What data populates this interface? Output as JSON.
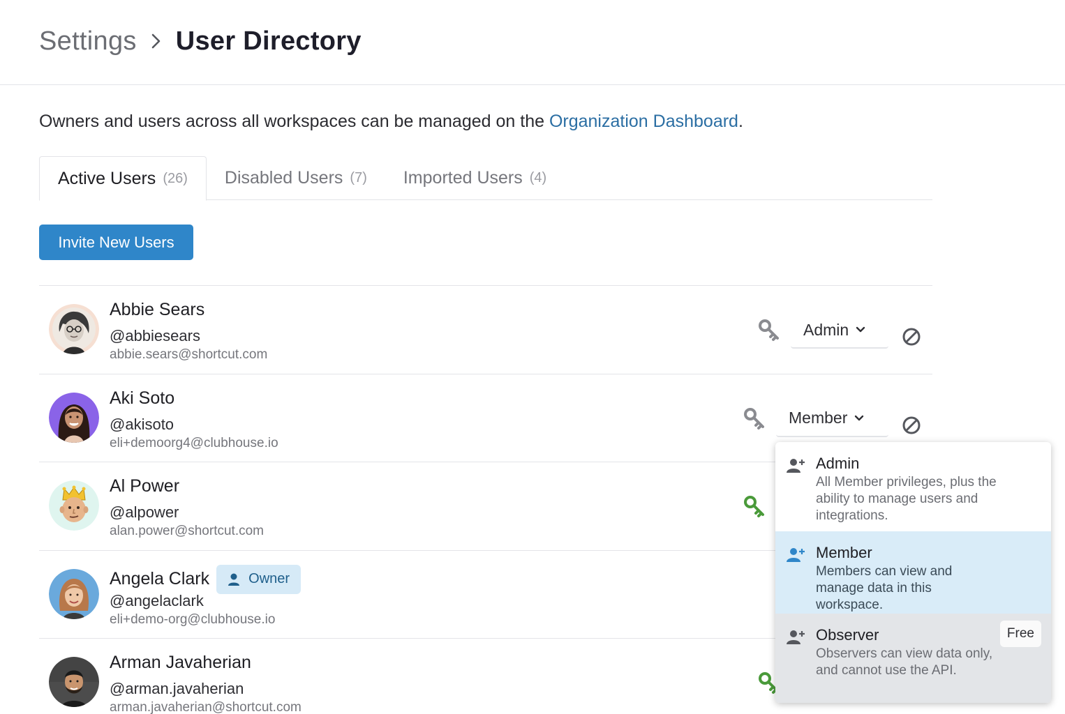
{
  "breadcrumb": {
    "parent": "Settings",
    "current": "User Directory"
  },
  "intro": {
    "text_before": "Owners and users across all workspaces can be managed on the ",
    "link": "Organization Dashboard",
    "text_after": "."
  },
  "tabs": [
    {
      "label": "Active Users",
      "count": "(26)",
      "active": true
    },
    {
      "label": "Disabled Users",
      "count": "(7)",
      "active": false
    },
    {
      "label": "Imported Users",
      "count": "(4)",
      "active": false
    }
  ],
  "invite_button": "Invite New Users",
  "users": [
    {
      "name": "Abbie Sears",
      "handle": "@abbiesears",
      "email": "abbie.sears@shortcut.com",
      "role": "Admin",
      "key_color": "#8a8b90"
    },
    {
      "name": "Aki Soto",
      "handle": "@akisoto",
      "email": "eli+demoorg4@clubhouse.io",
      "role": "Member",
      "key_color": "#8a8b90"
    },
    {
      "name": "Al Power",
      "handle": "@alpower",
      "email": "alan.power@shortcut.com",
      "key_color": "#4a9a3a"
    },
    {
      "name": "Angela Clark",
      "handle": "@angelaclark",
      "email": "eli+demo-org@clubhouse.io",
      "badge": "Owner"
    },
    {
      "name": "Arman Javaherian",
      "handle": "@arman.javaherian",
      "email": "arman.javaherian@shortcut.com",
      "key_color": "#4a9a3a"
    }
  ],
  "role_dropdown": {
    "options": [
      {
        "title": "Admin",
        "description": "All Member privileges, plus the ability to manage users and integrations."
      },
      {
        "title": "Member",
        "description": "Members can view and manage data in this workspace."
      },
      {
        "title": "Observer",
        "description": "Observers can view data only, and cannot use the API.",
        "badge": "Free"
      }
    ]
  },
  "colors": {
    "accent": "#2f86c9",
    "link": "#2b6ea3",
    "selected_bg": "#d9ecf8",
    "owner_badge_bg": "#d6eaf7"
  }
}
